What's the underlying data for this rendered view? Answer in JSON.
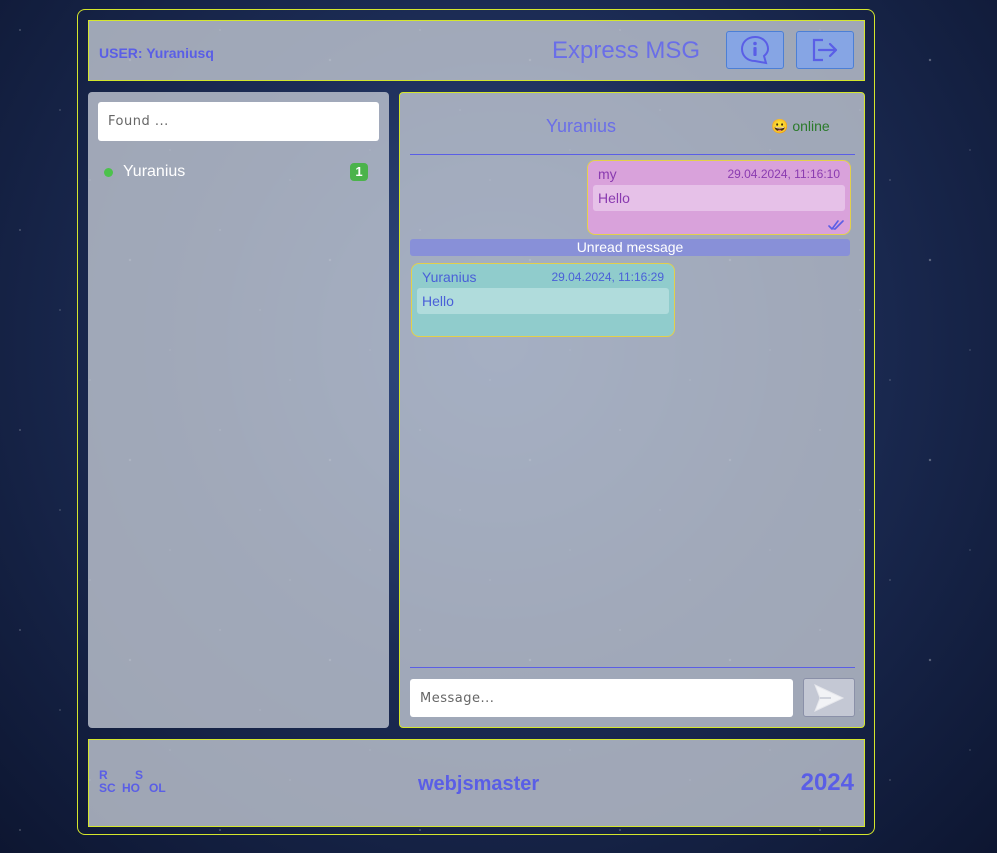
{
  "header": {
    "user_label": "USER: Yuraniusq",
    "app_title": "Express MSG",
    "info_icon": "info-bubble-icon",
    "logout_icon": "logout-icon"
  },
  "sidebar": {
    "search_placeholder": "Found ...",
    "contacts": [
      {
        "name": "Yuranius",
        "status": "online",
        "unread_count": "1"
      }
    ]
  },
  "chat": {
    "contact_name": "Yuranius",
    "status_emoji": "😀",
    "status_text": "online",
    "messages": [
      {
        "author": "my",
        "time": "29.04.2024, 11:16:10",
        "text": "Hello",
        "read": true
      },
      {
        "author": "Yuranius",
        "time": "29.04.2024, 11:16:29",
        "text": "Hello"
      }
    ],
    "unread_separator": "Unread message",
    "input_placeholder": "Message..."
  },
  "footer": {
    "logo_letters": [
      "R",
      "S",
      "SC",
      "HO",
      "OL"
    ],
    "author": "webjsmaster",
    "year": "2024"
  },
  "colors": {
    "accent": "#5a5ee6",
    "frame_border": "#d4e62c",
    "my_bubble": "#d9a2db",
    "their_bubble": "#90cccc",
    "online": "#4cc24c"
  }
}
